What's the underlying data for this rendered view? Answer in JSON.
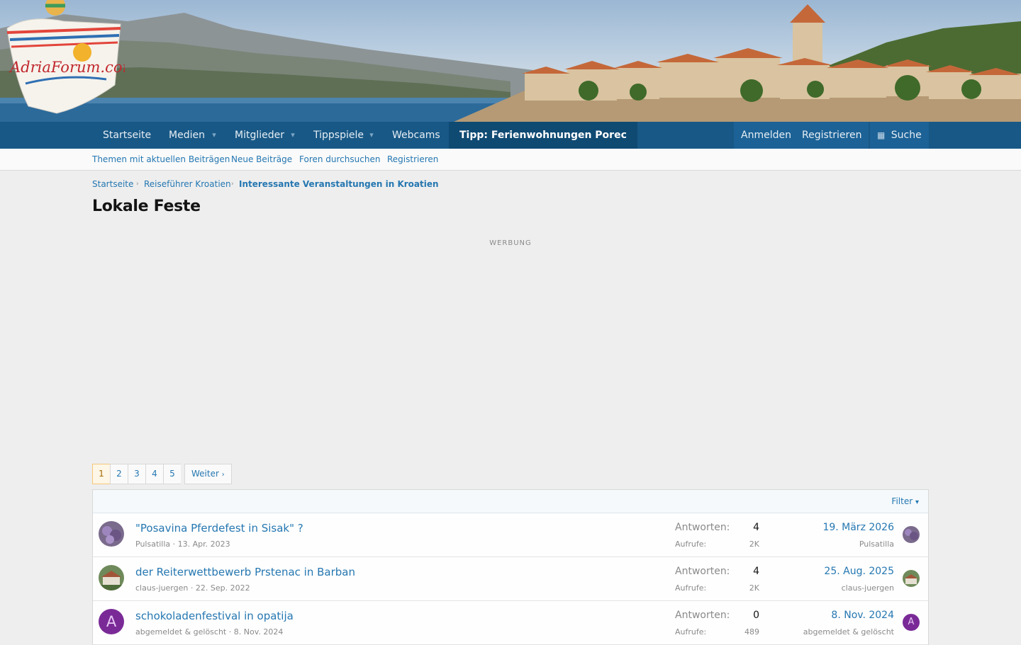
{
  "logo_text": "AdriaForum.com",
  "nav": {
    "items": [
      "Startseite",
      "Medien",
      "Mitglieder",
      "Tippspiele",
      "Webcams"
    ],
    "tip": "Tipp: Ferienwohnungen Porec",
    "login": "Anmelden",
    "register": "Registrieren",
    "search": "Suche"
  },
  "subnav": [
    "Themen mit aktuellen Beiträgen",
    "Neue Beiträge",
    "Foren durchsuchen",
    "Registrieren"
  ],
  "breadcrumb": [
    "Startseite",
    "Reiseführer Kroatien",
    "Interessante Veranstaltungen in Kroatien"
  ],
  "page_title": "Lokale Feste",
  "ad_label": "WERBUNG",
  "pagination": {
    "pages": [
      "1",
      "2",
      "3",
      "4",
      "5"
    ],
    "current": "1",
    "next": "Weiter"
  },
  "filter_label": "Filter",
  "labels": {
    "replies": "Antworten:",
    "views": "Aufrufe:"
  },
  "threads": [
    {
      "title": "\"Posavina Pferdefest in Sisak\" ?",
      "author": "Pulsatilla",
      "date": "13. Apr. 2023",
      "replies": "4",
      "views": "2K",
      "last_date": "19. März 2026",
      "last_user": "Pulsatilla"
    },
    {
      "title": "der Reiterwettbewerb Prstenac in Barban",
      "author": "claus-juergen",
      "date": "22. Sep. 2022",
      "replies": "4",
      "views": "2K",
      "last_date": "25. Aug. 2025",
      "last_user": "claus-juergen"
    },
    {
      "title": "schokoladenfestival in opatija",
      "author": "abgemeldet & gelöscht",
      "date": "8. Nov. 2024",
      "replies": "0",
      "views": "489",
      "last_date": "8. Nov. 2024",
      "last_user": "abgemeldet & gelöscht",
      "avatar_letter": "A"
    }
  ],
  "colors": {
    "nav": "#185886",
    "link": "#2577b1",
    "accent": "#f5c77a"
  }
}
